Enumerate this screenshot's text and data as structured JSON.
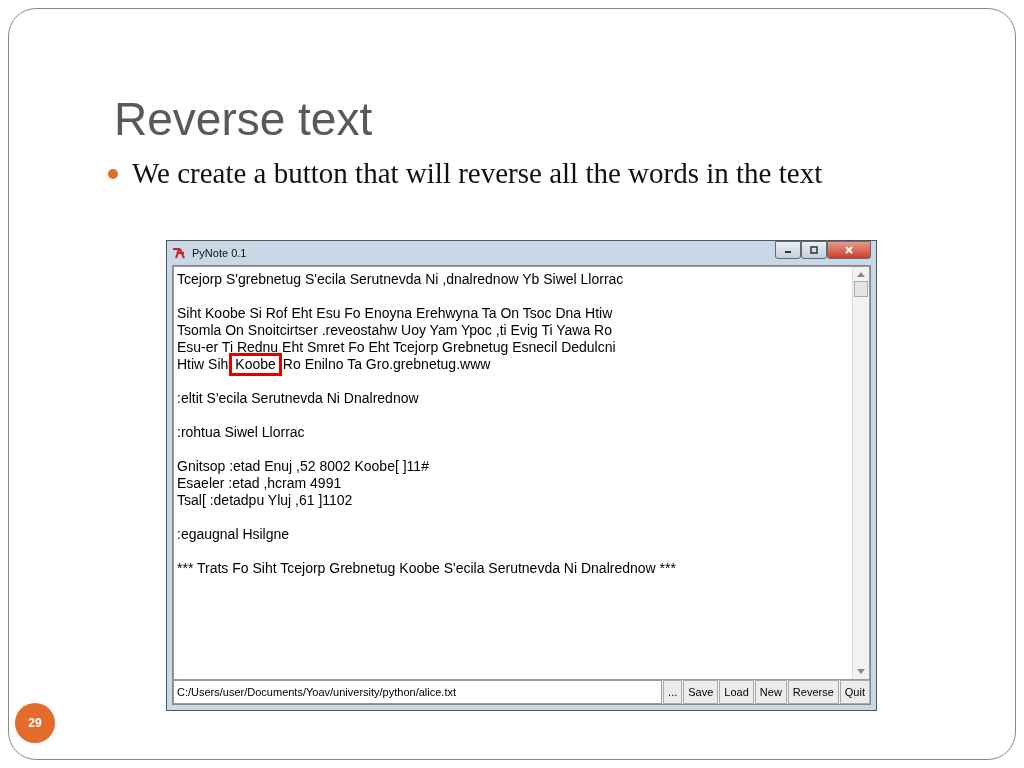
{
  "slide": {
    "title": "Reverse text",
    "bullets": [
      "We create a button that will reverse all the words in the text"
    ],
    "page_number": "29"
  },
  "window": {
    "title": "PyNote 0.1"
  },
  "editor": {
    "paragraphs": [
      {
        "lines": [
          "Tcejorp S'grebnetug S'ecila Serutnevda Ni ,dnalrednow Yb Siwel Llorrac"
        ]
      },
      {
        "lines": [
          "Siht Koobe Si Rof Eht Esu Fo Enoyna Erehwyna Ta On Tsoc Dna Htiw",
          "Tsomla On Snoitcirtser .reveostahw  Uoy Yam Ypoc ,ti Evig Ti Yawa Ro",
          "Esu-er Ti Rednu Eht Smret Fo Eht Tcejorp Grebnetug Esnecil Dedulcni",
          [
            {
              "text": "Htiw Sih",
              "highlighted": false
            },
            {
              "text": "Koobe",
              "highlighted": true
            },
            {
              "text": "Ro Enilno Ta Gro.grebnetug.www",
              "highlighted": false
            }
          ]
        ]
      },
      {
        "lines": [
          ":eltit S'ecila Serutnevda Ni Dnalrednow"
        ],
        "extra_gap": true
      },
      {
        "lines": [
          ":rohtua Siwel Llorrac"
        ]
      },
      {
        "lines": [
          "Gnitsop :etad Enuj ,52 8002 Koobe[ ]11#",
          "Esaeler :etad ,hcram 4991",
          "Tsal[ :detadpu Yluj ,61 ]1102"
        ]
      },
      {
        "lines": [
          ":egaugnal Hsilgne"
        ]
      },
      {
        "lines": [
          "*** Trats Fo Siht Tcejorp Grebnetug Koobe S'ecila Serutnevda Ni Dnalrednow ***"
        ],
        "extra_gap": true
      }
    ]
  },
  "path_field": {
    "value": "C:/Users/user/Documents/Yoav/university/python/alice.txt"
  },
  "buttons": [
    "...",
    "Save",
    "Load",
    "New",
    "Reverse",
    "Quit"
  ]
}
